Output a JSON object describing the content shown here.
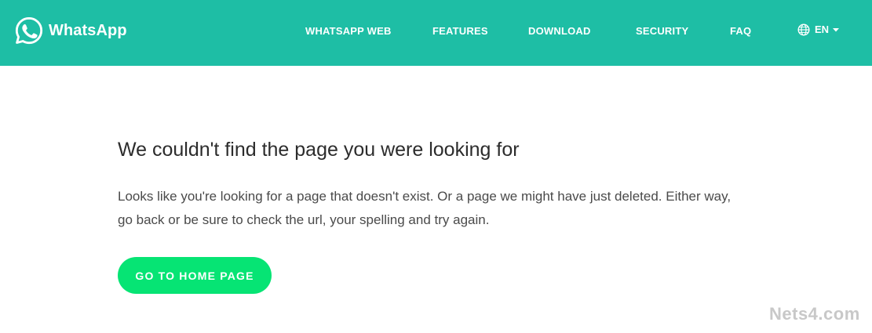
{
  "header": {
    "brand_name": "WhatsApp",
    "brand_color": "#1ebea5",
    "logo_icon": "whatsapp-logo-icon",
    "nav": [
      {
        "label": "WHATSAPP WEB"
      },
      {
        "label": "FEATURES"
      },
      {
        "label": "DOWNLOAD"
      },
      {
        "label": "SECURITY"
      },
      {
        "label": "FAQ"
      }
    ],
    "language": {
      "icon": "globe-icon",
      "code": "EN",
      "caret_icon": "caret-down-icon"
    }
  },
  "main": {
    "heading": "We couldn't find the page you were looking for",
    "message": "Looks like you're looking for a page that doesn't exist. Or a page we might have just deleted. Either way, go back or be sure to check the url, your spelling and try again.",
    "home_button": {
      "label": "GO TO HOME PAGE",
      "color": "#06e474"
    }
  },
  "watermark": "Nets4.com"
}
